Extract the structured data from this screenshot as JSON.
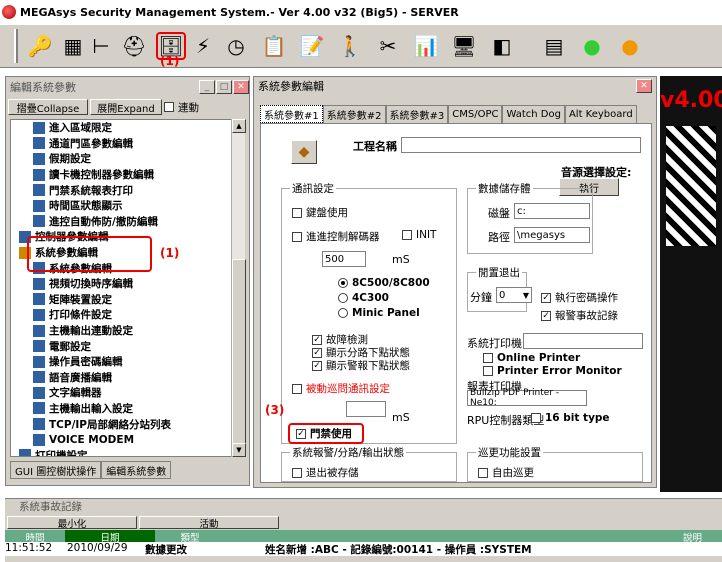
{
  "app": {
    "title": "MEGAsys Security Management System.- Ver 4.00 v32 (Big5) - SERVER"
  },
  "annotations": {
    "a1_toolbar": "(1)",
    "a1_tree": "(1)",
    "a2_tree": "(2)",
    "a3_dialog": "(3)"
  },
  "bg_text": "v4.00",
  "left_panel": {
    "title": "編輯系統參數",
    "collapse": "摺疊Collapse",
    "expand": "展開Expand",
    "check_label": "連動",
    "items": [
      "進入區域限定",
      "通道門區參數編輯",
      "假期設定",
      "讀卡機控制器參數編輯",
      "門禁系統報表打印",
      "時間區狀態顯示",
      "進控自動佈防/撤防編輯",
      "控制器參數編輯",
      "系統參數編輯",
      "系統參數編輯",
      "視頻切換時序編輯",
      "矩陣裝置設定",
      "打印條件設定",
      "主機輸出連動設定",
      "電郵設定",
      "操作員密碼編輯",
      "語音廣播編輯",
      "文字編輯器",
      "主機輸出輸入設定",
      "TCP/IP局部網絡分站列表",
      "VOICE MODEM",
      "打印機設定"
    ],
    "tabs": [
      "GUI 圖控樹狀操作",
      "編輯系統參數"
    ]
  },
  "dialog": {
    "title": "系統參數編輯",
    "tabs": [
      "系統參數#1",
      "系統參數#2",
      "系統參數#3",
      "CMS/OPC",
      "Watch Dog",
      "Alt Keyboard"
    ],
    "project_label": "工程名稱",
    "project_value": "",
    "sound_label": "音源選擇設定:",
    "exec_label": "執行",
    "comm": {
      "title": "通訊設定",
      "keypad": "鍵盤使用",
      "gate_ctrl": "進進控制解碼器",
      "init": "INIT",
      "ms_value": "500",
      "ms": "mS",
      "radio1": "8C500/8C800",
      "radio2": "4C300",
      "radio3": "Minic Panel",
      "chk1": "故障檢測",
      "chk2": "顯示分路下點狀態",
      "chk3": "顯示警報下點狀態",
      "patrol": "被動巡問通訊設定",
      "patrol_ms": "mS",
      "door": "門禁使用"
    },
    "storage": {
      "title": "數據儲存體",
      "disk_label": "磁盤",
      "disk_value": "c:",
      "path_label": "路徑",
      "path_value": "\\megasys"
    },
    "idle": {
      "title": "閒置退出",
      "minute_label": "分鐘",
      "minute_value": "0",
      "chk1": "執行密碼操作",
      "chk2": "報警事故記錄"
    },
    "printer": {
      "label": "系統打印機",
      "value": "",
      "online": "Online Printer",
      "error": "Printer Error Monitor",
      "report_label": "報表打印機",
      "report_value": "Bullzip PDF Printer - Ne10:",
      "rpu_label": "RPU控制器類型",
      "rpu_16": "16 bit type"
    },
    "alarm": {
      "title": "系統報警/分路/輸出狀態",
      "chk": "退出被存儲"
    },
    "patrol_group": {
      "title": "巡更功能設置",
      "chk": "自由巡更"
    }
  },
  "log": {
    "title": "系統事故記錄",
    "minimize": "最小化",
    "active": "活動",
    "headers": [
      "時間",
      "日期",
      "類型",
      "說明"
    ],
    "row": {
      "time": "11:51:52",
      "date": "2010/09/29",
      "type": "數據更改",
      "desc": "姓名新增 :ABC - 記錄編號:00141 - 操作員 :SYSTEM"
    }
  }
}
